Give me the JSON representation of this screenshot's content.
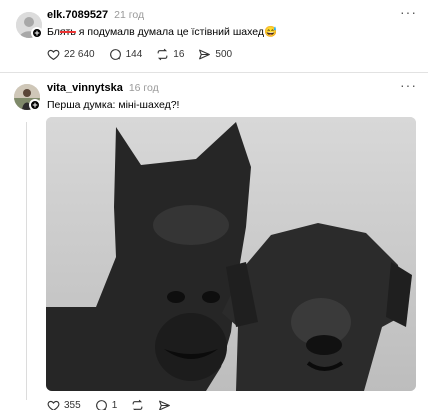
{
  "posts": [
    {
      "username": "elk.7089527",
      "time": "21 год",
      "text_struck": "Бл",
      "text_mark": "ять",
      "text_rest": " я подумалв думала це їстівний шахед",
      "emoji": "😅",
      "stats": {
        "likes": "22 640",
        "comments": "144",
        "reposts": "16",
        "shares": "500"
      }
    },
    {
      "username": "vita_vinnytska",
      "time": "16 год",
      "text": "Перша думка: міні-шахед?!",
      "stats": {
        "likes": "355",
        "comments": "1"
      }
    }
  ],
  "icons": {
    "like": "heart-icon",
    "comment": "comment-icon",
    "repost": "repost-icon",
    "share": "send-icon",
    "more": "more-icon",
    "follow": "plus-icon"
  },
  "colors": {
    "strike": "#e33333",
    "muted": "#999999"
  }
}
